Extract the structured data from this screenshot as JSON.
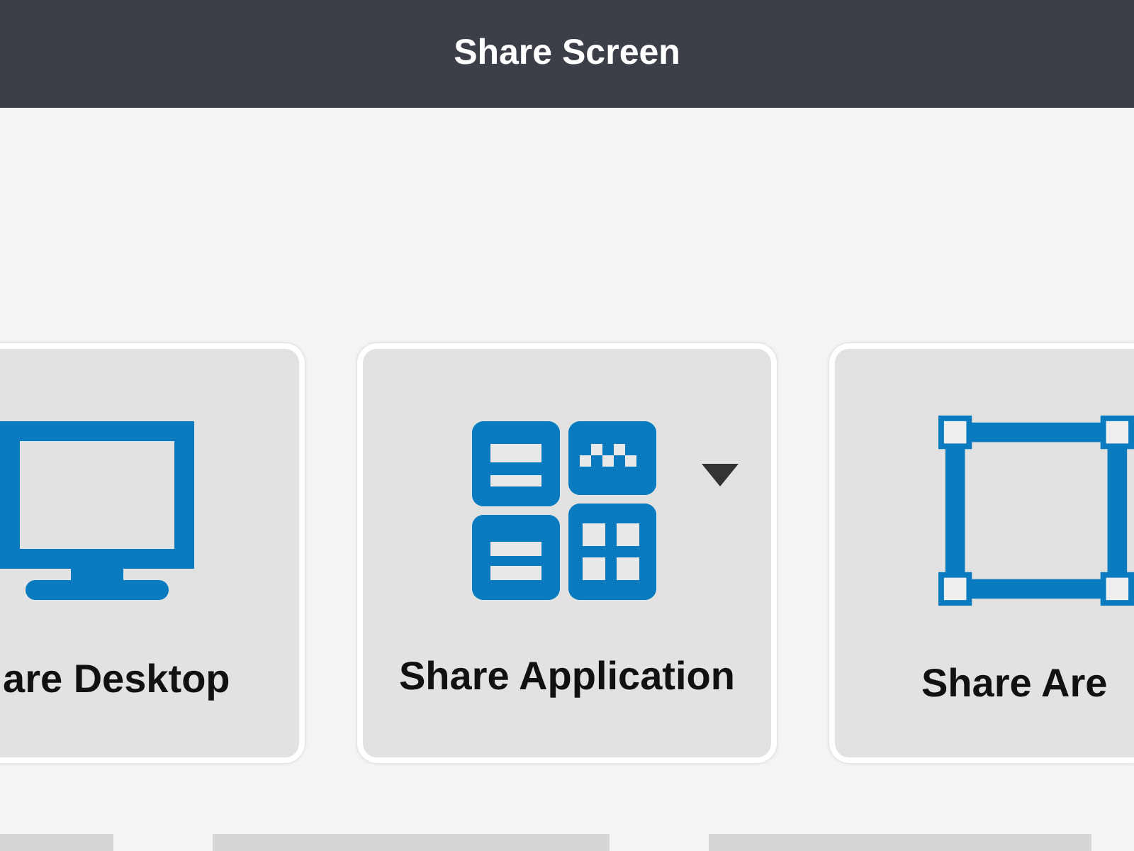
{
  "window": {
    "title": "Share Screen"
  },
  "options": [
    {
      "label": "are Desktop",
      "kind": "monitor",
      "dropdown": false
    },
    {
      "label": "Share Application",
      "kind": "apps",
      "dropdown": true
    },
    {
      "label": "Share Are",
      "kind": "area",
      "dropdown": false
    }
  ]
}
